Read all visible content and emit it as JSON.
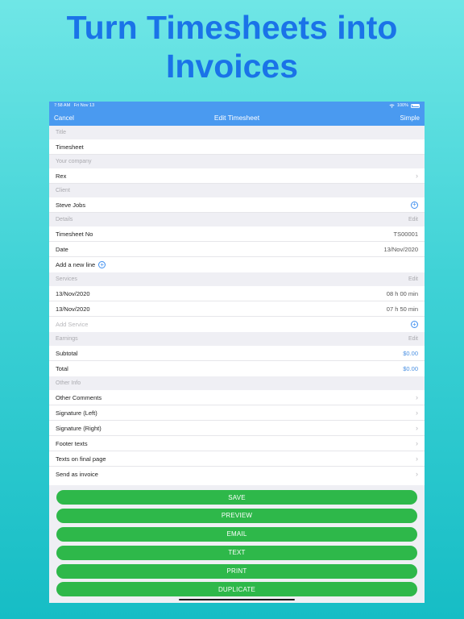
{
  "headline": {
    "line1": "Turn Timesheets into",
    "line2": "Invoices"
  },
  "status": {
    "time": "7:58 AM",
    "date": "Fri Nov 13",
    "battery": "100%"
  },
  "nav": {
    "left": "Cancel",
    "title": "Edit Timesheet",
    "right": "Simple"
  },
  "sections": {
    "title": {
      "header": "Title",
      "value": "Timesheet"
    },
    "company": {
      "header": "Your company",
      "value": "Rex"
    },
    "client": {
      "header": "Client",
      "value": "Steve Jobs"
    },
    "details": {
      "header": "Details",
      "edit": "Edit",
      "timesheet_no_label": "Timesheet No",
      "timesheet_no": "TS00001",
      "date_label": "Date",
      "date": "13/Nov/2020",
      "add_line": "Add a new line"
    },
    "services": {
      "header": "Services",
      "edit": "Edit",
      "items": [
        {
          "date": "13/Nov/2020",
          "duration": "08 h 00 min"
        },
        {
          "date": "13/Nov/2020",
          "duration": "07 h 50 min"
        }
      ],
      "add_placeholder": "Add Service"
    },
    "earnings": {
      "header": "Earnings",
      "edit": "Edit",
      "subtotal_label": "Subtotal",
      "subtotal": "$0.00",
      "total_label": "Total",
      "total": "$0.00"
    },
    "other": {
      "header": "Other Info",
      "items": [
        "Other Comments",
        "Signature (Left)",
        "Signature (Right)",
        "Footer texts",
        "Texts on final page",
        "Send as invoice"
      ]
    }
  },
  "buttons": [
    "SAVE",
    "PREVIEW",
    "EMAIL",
    "TEXT",
    "PRINT",
    "DUPLICATE"
  ],
  "icons": {
    "chevron": "chevron-right-icon",
    "add": "plus-circle-icon",
    "wifi": "wifi-icon",
    "battery": "battery-icon"
  },
  "colors": {
    "accent": "#4a9af0",
    "button": "#2eb84a",
    "headline": "#1a73e8"
  }
}
